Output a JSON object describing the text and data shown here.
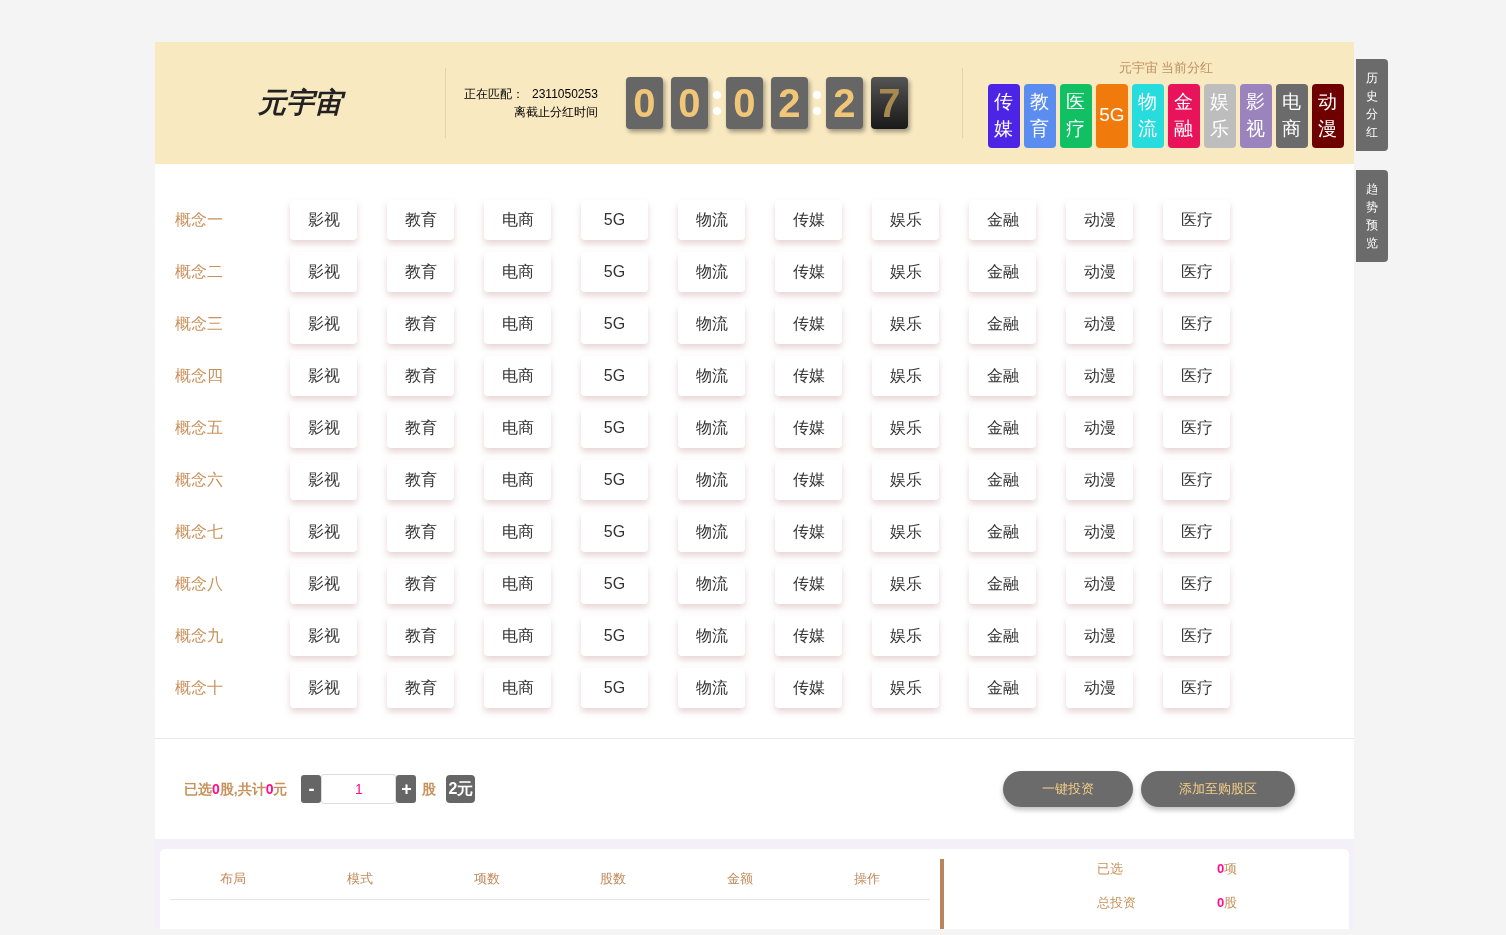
{
  "header": {
    "logo": "元宇宙",
    "matching_label": "正在匹配：",
    "matching_value": "2311050253",
    "countdown_label": "离截止分红时间",
    "countdown": [
      {
        "kind": "digit",
        "text": "0",
        "flipping": false
      },
      {
        "kind": "digit",
        "text": "0",
        "flipping": false
      },
      {
        "kind": "colon"
      },
      {
        "kind": "digit",
        "text": "0",
        "flipping": false
      },
      {
        "kind": "digit",
        "text": "2",
        "flipping": false
      },
      {
        "kind": "colon"
      },
      {
        "kind": "digit",
        "text": "2",
        "flipping": false
      },
      {
        "kind": "digit",
        "text": "7",
        "flipping": true
      }
    ],
    "dividend_title": "元宇宙 当前分红",
    "sectors": [
      {
        "label": "传媒",
        "color": "#4b24e6"
      },
      {
        "label": "教育",
        "color": "#5b8cf0"
      },
      {
        "label": "医疗",
        "color": "#12c064"
      },
      {
        "label": "5G",
        "color": "#f07a0c"
      },
      {
        "label": "物流",
        "color": "#26dcdc"
      },
      {
        "label": "金融",
        "color": "#e8135a"
      },
      {
        "label": "娱乐",
        "color": "#bdbdbd"
      },
      {
        "label": "影视",
        "color": "#9b84be"
      },
      {
        "label": "电商",
        "color": "#6b6b6b"
      },
      {
        "label": "动漫",
        "color": "#6e0000"
      }
    ]
  },
  "side_tabs": [
    "历史分红",
    "趋势预览"
  ],
  "concepts": [
    {
      "label": "概念一",
      "options": [
        "影视",
        "教育",
        "电商",
        "5G",
        "物流",
        "传媒",
        "娱乐",
        "金融",
        "动漫",
        "医疗"
      ]
    },
    {
      "label": "概念二",
      "options": [
        "影视",
        "教育",
        "电商",
        "5G",
        "物流",
        "传媒",
        "娱乐",
        "金融",
        "动漫",
        "医疗"
      ]
    },
    {
      "label": "概念三",
      "options": [
        "影视",
        "教育",
        "电商",
        "5G",
        "物流",
        "传媒",
        "娱乐",
        "金融",
        "动漫",
        "医疗"
      ]
    },
    {
      "label": "概念四",
      "options": [
        "影视",
        "教育",
        "电商",
        "5G",
        "物流",
        "传媒",
        "娱乐",
        "金融",
        "动漫",
        "医疗"
      ]
    },
    {
      "label": "概念五",
      "options": [
        "影视",
        "教育",
        "电商",
        "5G",
        "物流",
        "传媒",
        "娱乐",
        "金融",
        "动漫",
        "医疗"
      ]
    },
    {
      "label": "概念六",
      "options": [
        "影视",
        "教育",
        "电商",
        "5G",
        "物流",
        "传媒",
        "娱乐",
        "金融",
        "动漫",
        "医疗"
      ]
    },
    {
      "label": "概念七",
      "options": [
        "影视",
        "教育",
        "电商",
        "5G",
        "物流",
        "传媒",
        "娱乐",
        "金融",
        "动漫",
        "医疗"
      ]
    },
    {
      "label": "概念八",
      "options": [
        "影视",
        "教育",
        "电商",
        "5G",
        "物流",
        "传媒",
        "娱乐",
        "金融",
        "动漫",
        "医疗"
      ]
    },
    {
      "label": "概念九",
      "options": [
        "影视",
        "教育",
        "电商",
        "5G",
        "物流",
        "传媒",
        "娱乐",
        "金融",
        "动漫",
        "医疗"
      ]
    },
    {
      "label": "概念十",
      "options": [
        "影视",
        "教育",
        "电商",
        "5G",
        "物流",
        "传媒",
        "娱乐",
        "金融",
        "动漫",
        "医疗"
      ]
    }
  ],
  "order": {
    "summary": "已选**0**股,共计**0**元",
    "minus": "-",
    "quantity": "1",
    "plus": "+",
    "unit": "股",
    "price": "2元",
    "buttons": [
      "一键投资",
      "添加至购股区"
    ]
  },
  "table": {
    "columns": [
      "布局",
      "模式",
      "项数",
      "股数",
      "金额",
      "操作"
    ]
  },
  "stats": [
    {
      "label": "已选",
      "value": "0",
      "unit": "项"
    },
    {
      "label": "总投资",
      "value": "0",
      "unit": "股"
    }
  ]
}
